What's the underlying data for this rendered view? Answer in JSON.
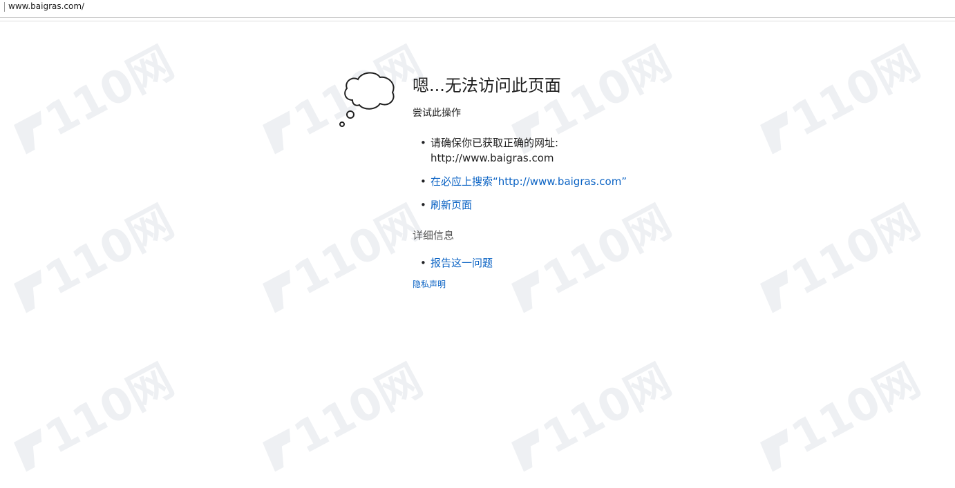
{
  "address_bar": {
    "url": "www.baigras.com/"
  },
  "error_page": {
    "title": "嗯...无法访问此页面",
    "subtitle": "尝试此操作",
    "suggestions": [
      {
        "text_line1": "请确保你已获取正确的网址:",
        "text_line2": "http://www.baigras.com"
      },
      {
        "link": "在必应上搜索“http://www.baigras.com”"
      },
      {
        "link": "刷新页面"
      }
    ],
    "details_heading": "详细信息",
    "details_items": [
      {
        "link": "报告这一问题"
      }
    ],
    "privacy_link": "隐私声明"
  },
  "watermark": {
    "text": "110网"
  },
  "colors": {
    "link": "#0b63c4",
    "text": "#1f1f1f",
    "secondary_text": "#555555"
  }
}
